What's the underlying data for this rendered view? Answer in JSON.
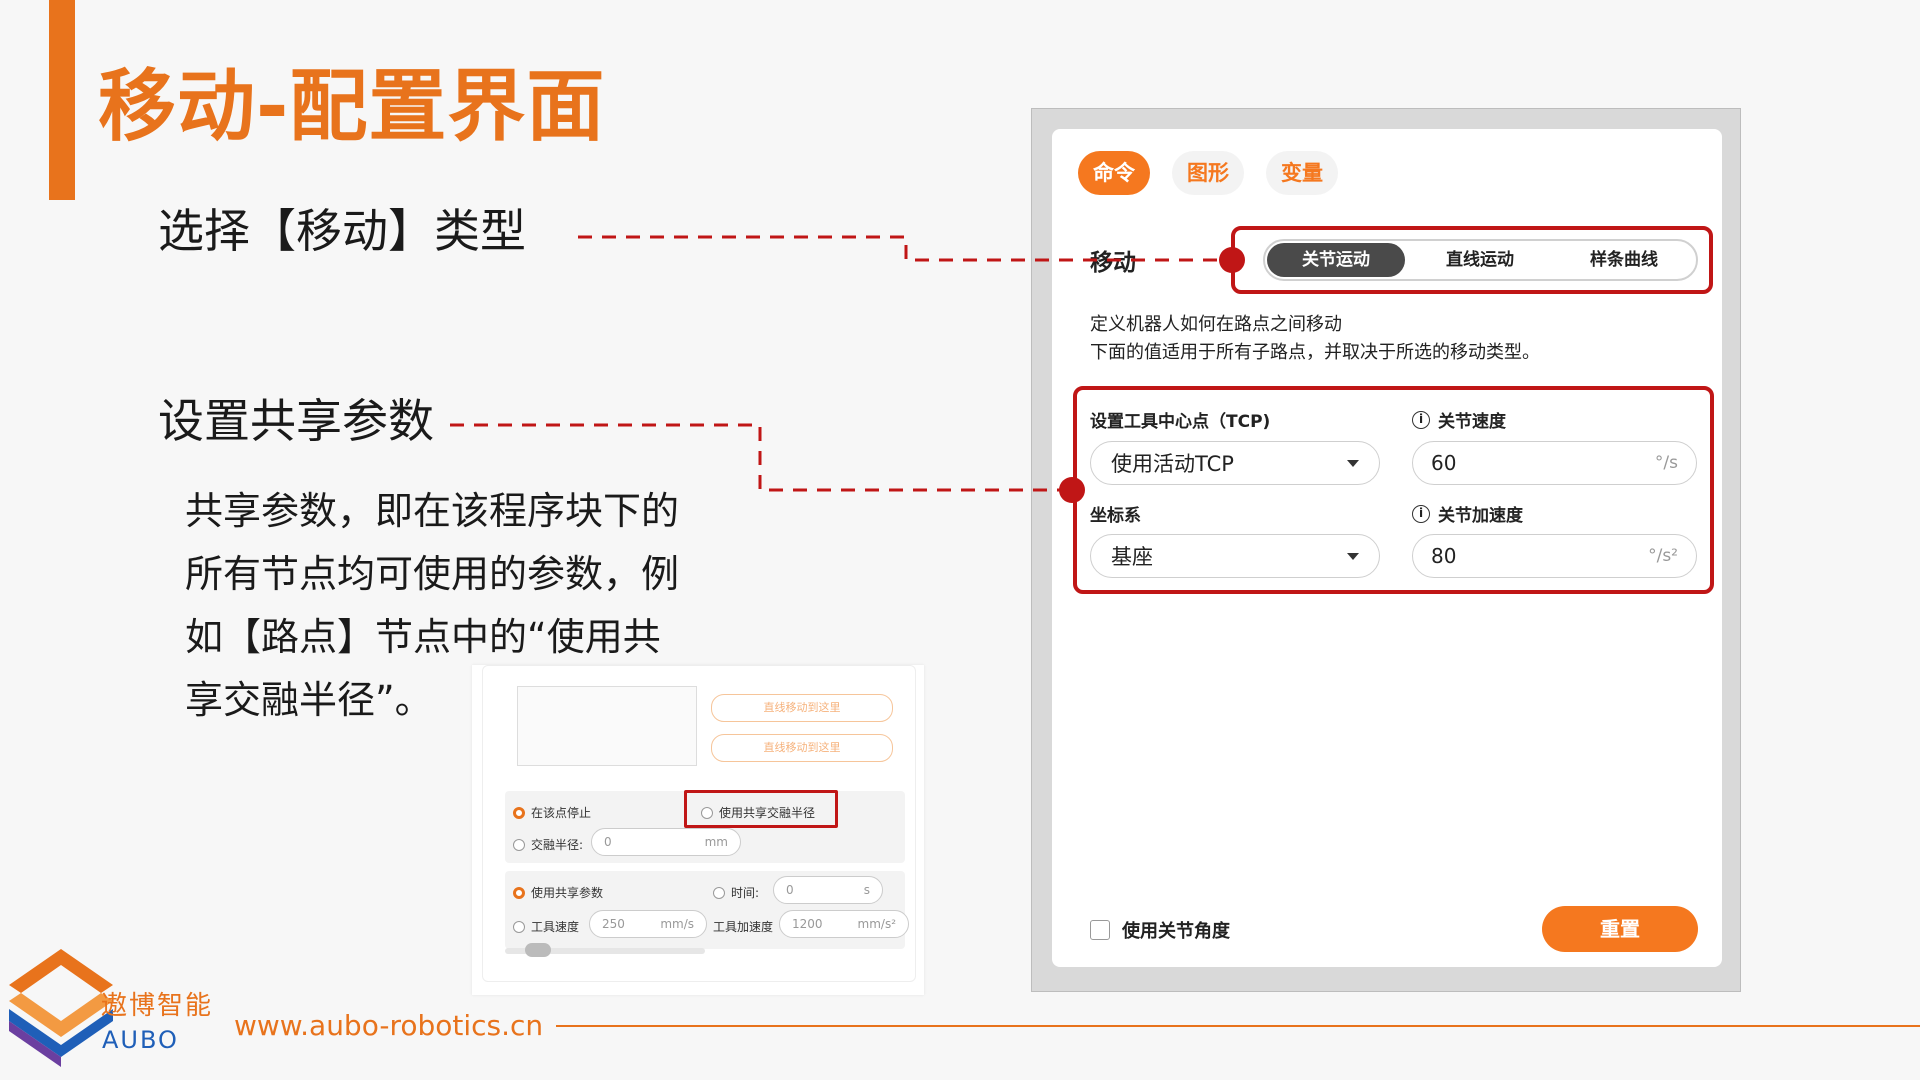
{
  "slide": {
    "title": "移动-配置界面",
    "callout_select": "选择【移动】类型",
    "callout_shared": "设置共享参数",
    "description_lines": [
      "共享参数，即在该程序块下的",
      "所有节点均可使用的参数，例",
      "如【路点】节点中的“使用共",
      "享交融半径”。"
    ],
    "accent_color": "#e8731c",
    "highlight_color": "#c01616"
  },
  "background_ui": {
    "ghost_buttons": [
      "直线移动到这里",
      "直线移动到这里"
    ],
    "stop_at_point": "在该点停止",
    "use_shared_blend": "使用共享交融半径",
    "blend_radius_label": "交融半径:",
    "blend_radius_value": "0",
    "blend_radius_unit": "mm",
    "use_shared_params": "使用共享参数",
    "time_label": "时间:",
    "time_value": "0",
    "time_unit": "s",
    "tool_speed_label": "工具速度",
    "tool_speed_value": "250",
    "tool_speed_unit": "mm/s",
    "tool_accel_label": "工具加速度",
    "tool_accel_value": "1200",
    "tool_accel_unit": "mm/s²"
  },
  "panel": {
    "tabs": [
      "命令",
      "图形",
      "变量"
    ],
    "active_tab": "命令",
    "move_label": "移动",
    "move_types": [
      "关节运动",
      "直线运动",
      "样条曲线"
    ],
    "active_move_type": "关节运动",
    "intro_lines": [
      "定义机器人如何在路点之间移动",
      "下面的值适用于所有子路点，并取决于所选的移动类型。"
    ],
    "tcp_label": "设置工具中心点（TCP)",
    "tcp_value": "使用活动TCP",
    "coord_label": "坐标系",
    "coord_value": "基座",
    "joint_speed_label": "关节速度",
    "joint_speed_value": "60",
    "joint_speed_unit": "°/s",
    "joint_accel_label": "关节加速度",
    "joint_accel_value": "80",
    "joint_accel_unit": "°/s²",
    "use_joint_angle": "使用关节角度",
    "reset_label": "重置",
    "accent_color": "#f5781f"
  },
  "footer": {
    "logo_cn": "遨博智能",
    "logo_en": "AUBO",
    "website": "www.aubo-robotics.cn"
  }
}
